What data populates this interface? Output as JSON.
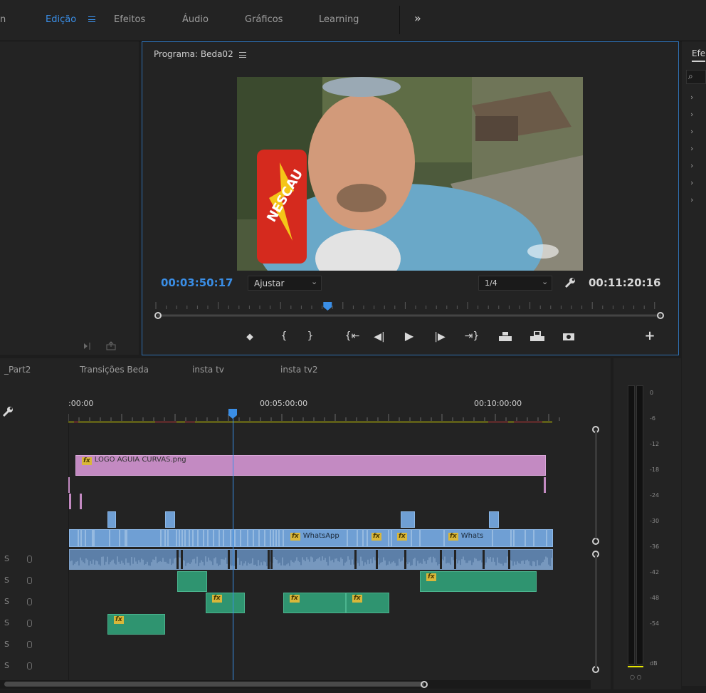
{
  "workspaces": {
    "partial_left": "n",
    "items": [
      "Edição",
      "Efeitos",
      "Áudio",
      "Gráficos",
      "Learning"
    ],
    "overflow": "»"
  },
  "program": {
    "title": "Programa: Beda02",
    "current_timecode": "00:03:50:17",
    "fit_label": "Ajustar",
    "resolution_label": "1/4",
    "duration_timecode": "00:11:20:16",
    "playhead_fraction": 0.338
  },
  "effects_panel": {
    "title_partial": "Efe",
    "rows": 7
  },
  "timeline": {
    "tabs": [
      "_Part2",
      "Transições Beda",
      "insta tv",
      "insta tv2"
    ],
    "ruler_labels": [
      ":00:00",
      "00:05:00:00",
      "00:10:00:00"
    ],
    "track_label": "S",
    "graphic_clip": "LOGO AGUIA CURVAS.png",
    "whatsapp_clip_1": "WhatsApp",
    "whatsapp_clip_2": "Whats",
    "fx_badge": "fx"
  },
  "audio_meter": {
    "scale": [
      "0",
      "-6",
      "-12",
      "-18",
      "-24",
      "-30",
      "-36",
      "-42",
      "-48",
      "-54"
    ],
    "unit": "dB",
    "solo_labels": "○ ○"
  },
  "colors": {
    "accent_blue": "#3a8ee6",
    "graphic_clip": "#c38ac2",
    "video_clip": "#6f9fd4",
    "audio_clip": "#5c7fa8",
    "audio_clip_green": "#2f9470",
    "work_area_yellow": "#e6e600",
    "render_red": "#d33a3a"
  }
}
